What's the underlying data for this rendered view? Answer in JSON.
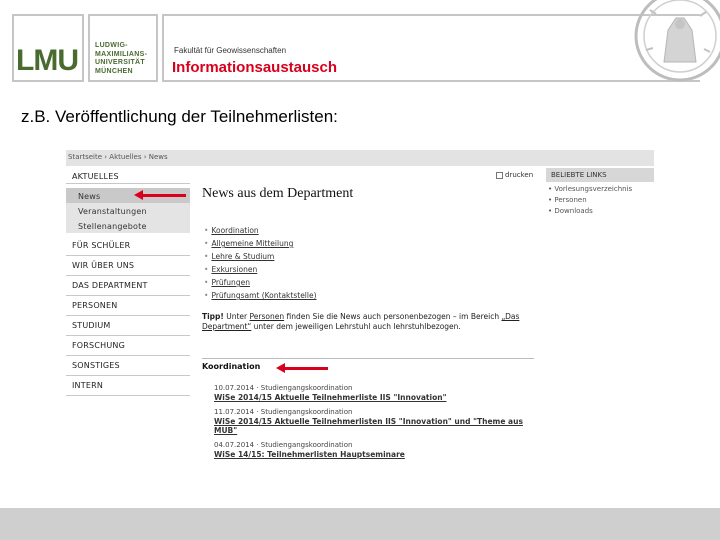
{
  "header": {
    "logo_text": "LMU",
    "university_lines": [
      "LUDWIG-",
      "MAXIMILIANS-",
      "UNIVERSITÄT",
      "MÜNCHEN"
    ],
    "faculty": "Fakultät für Geowissenschaften",
    "title": "Informationsaustausch"
  },
  "headline": "z.B. Veröffentlichung der Teilnehmerlisten:",
  "screenshot": {
    "breadcrumb": "Startseite › Aktuelles › News",
    "nav": [
      {
        "label": "AKTUELLES",
        "level": 0
      },
      {
        "label": "News",
        "level": 1,
        "active": true
      },
      {
        "label": "Veranstaltungen",
        "level": 1
      },
      {
        "label": "Stellenangebote",
        "level": 1
      },
      {
        "label": "FÜR SCHÜLER",
        "level": 0
      },
      {
        "label": "WIR ÜBER UNS",
        "level": 0
      },
      {
        "label": "DAS DEPARTMENT",
        "level": 0
      },
      {
        "label": "PERSONEN",
        "level": 0
      },
      {
        "label": "STUDIUM",
        "level": 0
      },
      {
        "label": "FORSCHUNG",
        "level": 0
      },
      {
        "label": "SONSTIGES",
        "level": 0
      },
      {
        "label": "INTERN",
        "level": 0
      }
    ],
    "print_label": "drucken",
    "news_title": "News aus dem Department",
    "news_links": [
      "Koordination",
      "Allgemeine Mitteilung",
      "Lehre & Studium",
      "Exkursionen",
      "Prüfungen",
      "Prüfungsamt (Kontaktstelle)"
    ],
    "tip": {
      "bold": "Tipp!",
      "part1": "Unter",
      "link1": "Personen",
      "part2": "finden Sie die News auch personenbezogen – im Bereich",
      "link2": "„Das Department“",
      "part3": "unter dem jeweiligen Lehrstuhl auch lehrstuhlbezogen."
    },
    "section_title": "Koordination",
    "entries": [
      {
        "meta": "10.07.2014 · Studiengangskoordination",
        "link": "WiSe 2014/15 Aktuelle Teilnehmerliste IIS \"Innovation\""
      },
      {
        "meta": "11.07.2014 · Studiengangskoordination",
        "link": "WiSe 2014/15 Aktuelle Teilnehmerlisten IIS \"Innovation\" und \"Theme aus MUB\""
      },
      {
        "meta": "04.07.2014 · Studiengangskoordination",
        "link": "WiSe 14/15: Teilnehmerlisten Hauptseminare"
      }
    ],
    "right_panel": {
      "title": "BELIEBTE LINKS",
      "links": [
        "Vorlesungsverzeichnis",
        "Personen",
        "Downloads"
      ]
    }
  },
  "colors": {
    "accent_red": "#d8001c",
    "lmu_green": "#4a6b2f",
    "nav_active": "#c9c9c9"
  }
}
